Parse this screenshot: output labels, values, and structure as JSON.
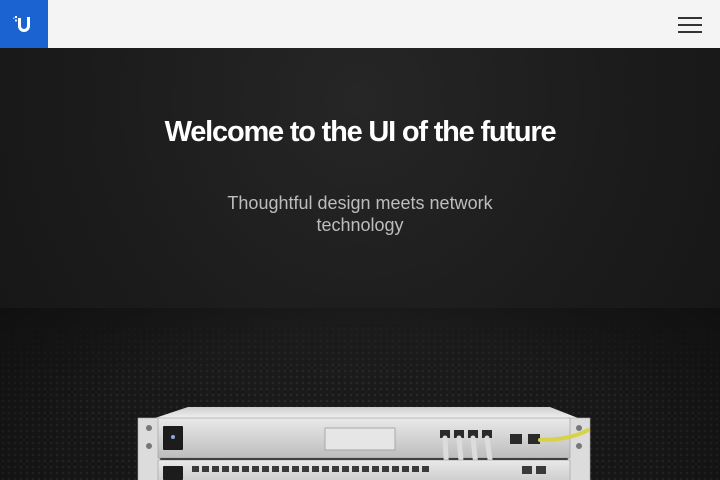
{
  "header": {
    "logo_letter": "U",
    "logo_color": "#1a63d1",
    "menu_icon": "hamburger-menu-icon"
  },
  "hero": {
    "title": "Welcome to the UI of the future",
    "subtitle": "Thoughtful design meets network technology"
  },
  "colors": {
    "background": "#1a1a1a",
    "topbar": "#f4f4f4",
    "accent": "#1a63d1",
    "cable_yellow": "#d8d24a"
  }
}
